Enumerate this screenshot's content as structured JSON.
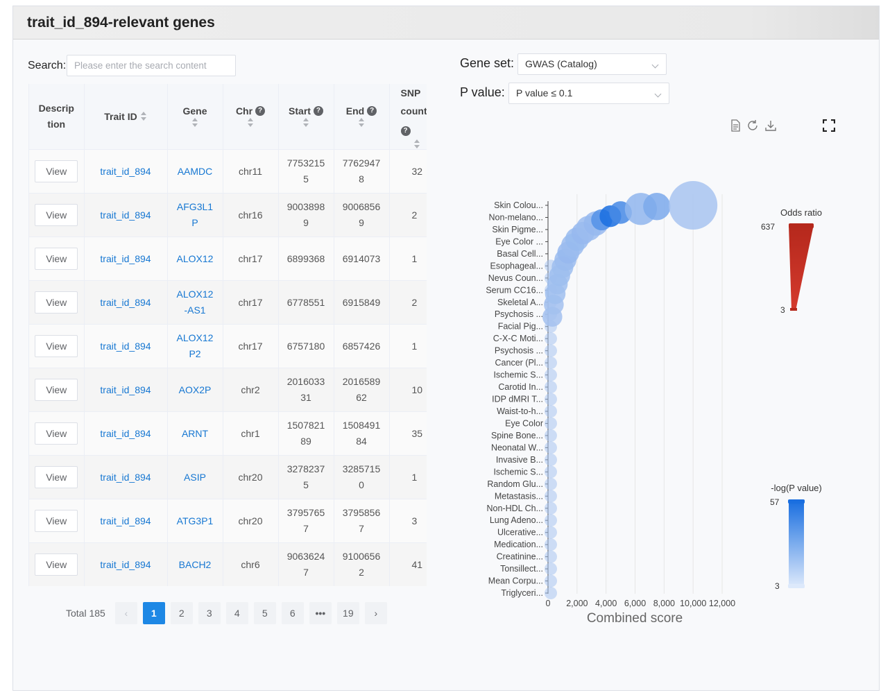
{
  "header": {
    "title": "trait_id_894-relevant genes"
  },
  "search": {
    "label": "Search:",
    "placeholder": "Please enter the search content"
  },
  "table": {
    "columns": [
      "Descrip tion",
      "Trait ID",
      "Gene",
      "Chr",
      "Start",
      "End",
      "SNP count"
    ],
    "rows": [
      {
        "action": "View",
        "trait": "trait_id_894",
        "gene": "AAMDC",
        "chr": "chr11",
        "start": "77532155",
        "end": "77629478",
        "snp": "32"
      },
      {
        "action": "View",
        "trait": "trait_id_894",
        "gene": "AFG3L1P",
        "chr": "chr16",
        "start": "90038989",
        "end": "90068569",
        "snp": "2"
      },
      {
        "action": "View",
        "trait": "trait_id_894",
        "gene": "ALOX12",
        "chr": "chr17",
        "start": "6899368",
        "end": "6914073",
        "snp": "1"
      },
      {
        "action": "View",
        "trait": "trait_id_894",
        "gene": "ALOX12-AS1",
        "chr": "chr17",
        "start": "6778551",
        "end": "6915849",
        "snp": "2"
      },
      {
        "action": "View",
        "trait": "trait_id_894",
        "gene": "ALOX12P2",
        "chr": "chr17",
        "start": "6757180",
        "end": "6857426",
        "snp": "1"
      },
      {
        "action": "View",
        "trait": "trait_id_894",
        "gene": "AOX2P",
        "chr": "chr2",
        "start": "201603331",
        "end": "201658962",
        "snp": "10"
      },
      {
        "action": "View",
        "trait": "trait_id_894",
        "gene": "ARNT",
        "chr": "chr1",
        "start": "150782189",
        "end": "150849184",
        "snp": "35"
      },
      {
        "action": "View",
        "trait": "trait_id_894",
        "gene": "ASIP",
        "chr": "chr20",
        "start": "32782375",
        "end": "32857150",
        "snp": "1"
      },
      {
        "action": "View",
        "trait": "trait_id_894",
        "gene": "ATG3P1",
        "chr": "chr20",
        "start": "37957657",
        "end": "37958567",
        "snp": "3"
      },
      {
        "action": "View",
        "trait": "trait_id_894",
        "gene": "BACH2",
        "chr": "chr6",
        "start": "90636247",
        "end": "91006562",
        "snp": "41"
      }
    ]
  },
  "pagination": {
    "total": "Total 185",
    "prev": "‹",
    "next": "›",
    "pages": [
      "1",
      "2",
      "3",
      "4",
      "5",
      "6",
      "•••",
      "19"
    ],
    "current": "1"
  },
  "filters": {
    "gene_set_label": "Gene set:",
    "gene_set_value": "GWAS (Catalog)",
    "p_value_label": "P value:",
    "p_value_value": "P value ≤ 0.1"
  },
  "toolbox": {
    "icons": [
      "data-view-icon",
      "restore-icon",
      "download-icon",
      "fullscreen-icon"
    ]
  },
  "colors": {
    "link": "#1677d2",
    "active_page": "#1e88e5",
    "odds_high": "#b5281c",
    "p_high": "#1a6fe0",
    "bubble": "#a8c4f0"
  },
  "chart_data": {
    "type": "scatter",
    "xlabel": "Combined score",
    "xlim": [
      0,
      12000
    ],
    "x_ticks": [
      "0",
      "2,000",
      "4,000",
      "6,000",
      "8,000",
      "10,000",
      "12,000"
    ],
    "categories": [
      "Skin Colou...",
      "Non-melano...",
      "Skin Pigme...",
      "Eye Color ...",
      "Basal Cell...",
      "Esophageal...",
      "Nevus Coun...",
      "Serum CC16...",
      "Skeletal A...",
      "Psychosis ...",
      "Facial Pig...",
      "C-X-C Moti...",
      "Psychosis ...",
      "Cancer (Pl...",
      "Ischemic S...",
      "Carotid In...",
      "IDP dMRI T...",
      "Waist-to-h...",
      "Eye Color",
      "Spine Bone...",
      "Neonatal W...",
      "Invasive B...",
      "Ischemic S...",
      "Random Glu...",
      "Metastasis...",
      "Non-HDL Ch...",
      "Lung Adeno...",
      "Ulcerative...",
      "Medication...",
      "Creatinine...",
      "Tonsillect...",
      "Mean Corpu...",
      "Triglyceri..."
    ],
    "points": [
      {
        "x": 10000,
        "y": 0,
        "odds": 637,
        "logp": 3
      },
      {
        "x": 7500,
        "y": 0.1,
        "odds": 120,
        "logp": 20
      },
      {
        "x": 6400,
        "y": 0.3,
        "odds": 200,
        "logp": 12
      },
      {
        "x": 5000,
        "y": 0.6,
        "odds": 60,
        "logp": 40
      },
      {
        "x": 4300,
        "y": 0.9,
        "odds": 50,
        "logp": 57
      },
      {
        "x": 3700,
        "y": 1.2,
        "odds": 45,
        "logp": 35
      },
      {
        "x": 3300,
        "y": 1.5,
        "odds": 80,
        "logp": 10
      },
      {
        "x": 2800,
        "y": 1.9,
        "odds": 90,
        "logp": 8
      },
      {
        "x": 2400,
        "y": 2.3,
        "odds": 60,
        "logp": 10
      },
      {
        "x": 2000,
        "y": 2.8,
        "odds": 70,
        "logp": 9
      },
      {
        "x": 1700,
        "y": 3.3,
        "odds": 65,
        "logp": 8
      },
      {
        "x": 1400,
        "y": 3.9,
        "odds": 55,
        "logp": 10
      },
      {
        "x": 1200,
        "y": 4.5,
        "odds": 55,
        "logp": 8
      },
      {
        "x": 1000,
        "y": 5.1,
        "odds": 50,
        "logp": 7
      },
      {
        "x": 800,
        "y": 5.8,
        "odds": 45,
        "logp": 7
      },
      {
        "x": 650,
        "y": 6.5,
        "odds": 40,
        "logp": 6
      },
      {
        "x": 500,
        "y": 7.3,
        "odds": 40,
        "logp": 6
      },
      {
        "x": 400,
        "y": 8.2,
        "odds": 35,
        "logp": 5
      },
      {
        "x": 300,
        "y": 9.2,
        "odds": 35,
        "logp": 5
      }
    ],
    "odds_ratio": {
      "title": "Odds ratio",
      "max": 637,
      "min": 3
    },
    "neg_log_p": {
      "title": "-log(P value)",
      "max": 57,
      "min": 3
    }
  }
}
